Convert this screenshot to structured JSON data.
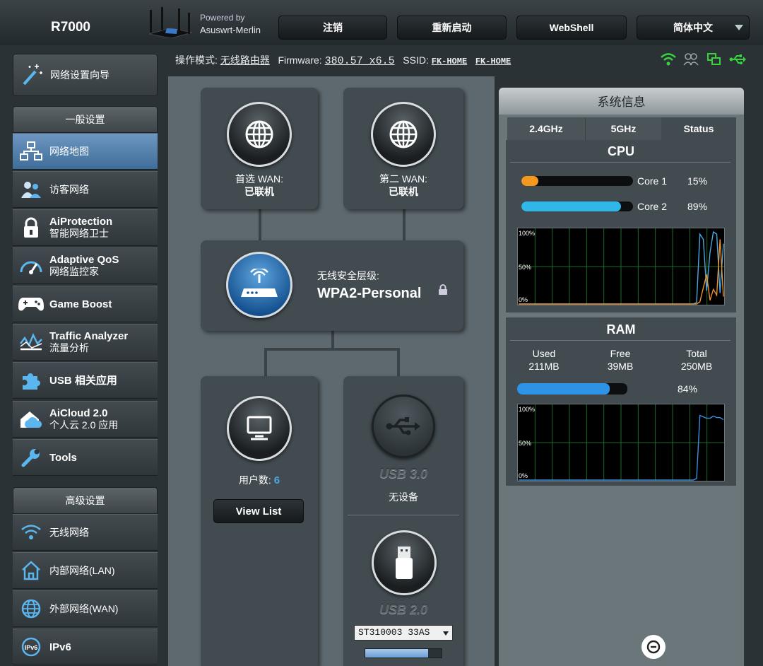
{
  "header": {
    "model": "R7000",
    "powered_by": "Powered by",
    "brand": "Asuswrt-Merlin",
    "buttons": [
      "注销",
      "重新启动",
      "WebShell",
      "简体中文"
    ]
  },
  "status_bar": {
    "mode_label": "操作模式:",
    "mode_value": "无线路由器",
    "firmware_label": "Firmware:",
    "firmware_value": "380.57_x6.5",
    "ssid_label": "SSID:",
    "ssid_1": "FK-HOME",
    "ssid_2": "FK-HOME",
    "icons": [
      "wifi-icon",
      "users-icon",
      "network-icon",
      "usb-icon"
    ]
  },
  "sidebar": {
    "wizard": "网络设置向导",
    "general_header": "一般设置",
    "items": [
      {
        "en": "",
        "cn": "网络地图",
        "icon": "network-map-icon"
      },
      {
        "en": "",
        "cn": "访客网络",
        "icon": "guest-icon"
      },
      {
        "en": "AiProtection",
        "cn": "智能网络卫士",
        "icon": "lock-icon"
      },
      {
        "en": "Adaptive QoS",
        "cn": "网络监控家",
        "icon": "gauge-icon"
      },
      {
        "en": "Game Boost",
        "cn": "",
        "icon": "gamepad-icon"
      },
      {
        "en": "Traffic Analyzer",
        "cn": "流量分析",
        "icon": "chart-icon"
      },
      {
        "en": "USB 相关应用",
        "cn": "",
        "icon": "puzzle-icon"
      },
      {
        "en": "AiCloud 2.0",
        "cn": "个人云 2.0 应用",
        "icon": "cloud-icon"
      },
      {
        "en": "Tools",
        "cn": "",
        "icon": "wrench-icon"
      }
    ],
    "advanced_header": "高级设置",
    "advanced_items": [
      {
        "label": "无线网络",
        "icon": "wifi-icon"
      },
      {
        "label": "内部网络(LAN)",
        "icon": "home-icon"
      },
      {
        "label": "外部网络(WAN)",
        "icon": "globe-icon"
      },
      {
        "label": "IPv6",
        "icon": "ipv6-icon"
      }
    ]
  },
  "network_map": {
    "wan1_label": "首选 WAN:",
    "wan1_status": "已联机",
    "wan2_label": "第二 WAN:",
    "wan2_status": "已联机",
    "security_label": "无线安全层级:",
    "security_value": "WPA2-Personal",
    "clients_label": "用户数:",
    "clients_count": "6",
    "view_list": "View List",
    "usb3_label": "USB 3.0",
    "usb3_status": "无设备",
    "usb2_label": "USB 2.0",
    "usb2_device": "ST310003 33AS",
    "usb2_usage": 0.82
  },
  "system_info": {
    "title": "系统信息",
    "tabs": [
      "2.4GHz",
      "5GHz",
      "Status"
    ],
    "cpu_title": "CPU",
    "cores": [
      {
        "name": "Core 1",
        "percent": "15%",
        "value": 15,
        "color": "#f39a1e"
      },
      {
        "name": "Core 2",
        "percent": "89%",
        "value": 89,
        "color": "#2fb7ea"
      }
    ],
    "ram_title": "RAM",
    "ram_labels": [
      "Used",
      "Free",
      "Total"
    ],
    "ram_values": [
      "211MB",
      "39MB",
      "250MB"
    ],
    "ram_percent": "84%",
    "ram_value": 84,
    "graph_labels": [
      "100%",
      "50%",
      "0%"
    ]
  },
  "chart_data": [
    {
      "type": "line",
      "title": "",
      "ylim": [
        0,
        100
      ],
      "series": [
        {
          "color": "#4aa8e0",
          "values": [
            0,
            0,
            0,
            0,
            0,
            0,
            0,
            0,
            0,
            0,
            0,
            0,
            0,
            0,
            0,
            0,
            0,
            0,
            0,
            0,
            0,
            0,
            0,
            0,
            0,
            0,
            0,
            0,
            0,
            0,
            0,
            0,
            0,
            0,
            0,
            0,
            0,
            0,
            0,
            0,
            0,
            0,
            0,
            0,
            0,
            0,
            0,
            0,
            0,
            0,
            0,
            0,
            0,
            2,
            95,
            88,
            18,
            70,
            98,
            95,
            15,
            82
          ]
        },
        {
          "color": "#f0902a",
          "values": [
            0,
            0,
            0,
            0,
            0,
            0,
            0,
            0,
            0,
            0,
            0,
            0,
            0,
            0,
            0,
            0,
            0,
            0,
            0,
            0,
            0,
            0,
            0,
            0,
            0,
            0,
            0,
            0,
            0,
            0,
            0,
            0,
            0,
            0,
            0,
            0,
            0,
            0,
            0,
            0,
            0,
            0,
            0,
            0,
            0,
            0,
            0,
            0,
            0,
            0,
            0,
            0,
            0,
            0,
            3,
            22,
            40,
            5,
            20,
            12,
            88,
            10
          ]
        }
      ]
    },
    {
      "type": "line",
      "title": "",
      "ylim": [
        0,
        100
      ],
      "series": [
        {
          "color": "#3b8fe0",
          "values": [
            0,
            0,
            0,
            0,
            0,
            0,
            0,
            0,
            0,
            0,
            0,
            0,
            0,
            0,
            0,
            0,
            0,
            0,
            0,
            0,
            0,
            0,
            0,
            0,
            0,
            0,
            0,
            0,
            0,
            0,
            0,
            0,
            0,
            0,
            0,
            0,
            0,
            0,
            0,
            0,
            0,
            0,
            0,
            0,
            0,
            0,
            0,
            0,
            0,
            0,
            0,
            0,
            0,
            2,
            88,
            86,
            84,
            84,
            87,
            85,
            85,
            82
          ]
        }
      ]
    }
  ]
}
